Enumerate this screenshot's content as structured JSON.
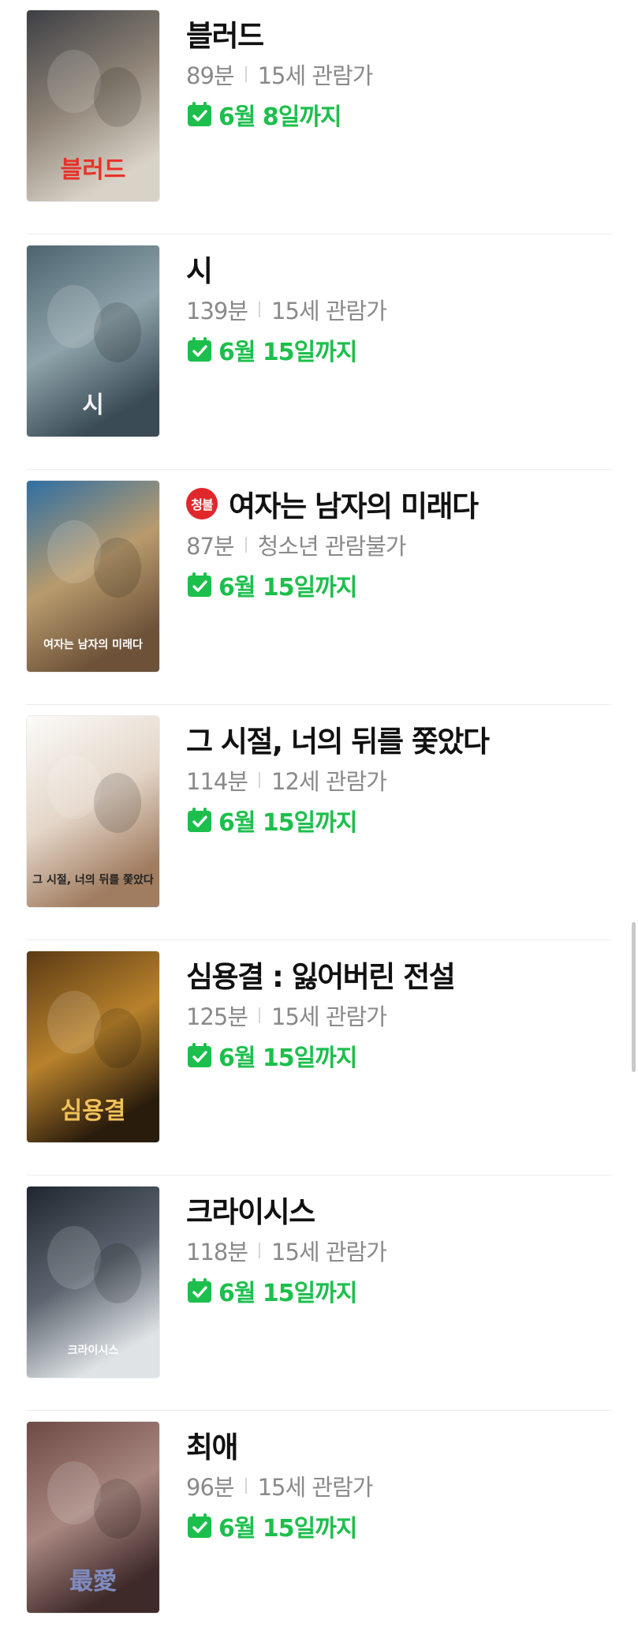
{
  "colors": {
    "accent_green": "#1dbf4c",
    "meta_gray": "#8a8a8a",
    "restricted_red": "#e0282c"
  },
  "icons": {
    "calendar": "calendar-check-icon"
  },
  "movies": [
    {
      "title": "블러드",
      "runtime": "89분",
      "rating": "15세 관람가",
      "until": "6월 8일까지",
      "badge": "",
      "poster_text": "블러드",
      "poster_colors": [
        "#3d3f44",
        "#8f8477",
        "#d9d2c7"
      ],
      "poster_text_color": "#e8322b"
    },
    {
      "title": "시",
      "runtime": "139분",
      "rating": "15세 관람가",
      "until": "6월 15일까지",
      "badge": "",
      "poster_text": "시",
      "poster_colors": [
        "#4d6470",
        "#8ea3aa",
        "#3a4b55"
      ],
      "poster_text_color": "#f2f2f2"
    },
    {
      "title": "여자는 남자의 미래다",
      "runtime": "87분",
      "rating": "청소년 관람불가",
      "until": "6월 15일까지",
      "badge": "청불",
      "poster_text": "여자는 남자의 미래다",
      "poster_colors": [
        "#2f6fa3",
        "#b89b6d",
        "#6d5239"
      ],
      "poster_text_color": "#ffffff"
    },
    {
      "title": "그 시절, 너의 뒤를 쫓았다",
      "runtime": "114분",
      "rating": "12세 관람가",
      "until": "6월 15일까지",
      "badge": "",
      "poster_text": "그 시절, 너의 뒤를 쫓았다",
      "poster_colors": [
        "#fbfbf9",
        "#e4d6c8",
        "#a07c60"
      ],
      "poster_text_color": "#222222"
    },
    {
      "title": "심용결 : 잃어버린 전설",
      "runtime": "125분",
      "rating": "15세 관람가",
      "until": "6월 15일까지",
      "badge": "",
      "poster_text": "심용결",
      "poster_colors": [
        "#5b3a14",
        "#b8822c",
        "#2a1c0c"
      ],
      "poster_text_color": "#f1c25a"
    },
    {
      "title": "크라이시스",
      "runtime": "118분",
      "rating": "15세 관람가",
      "until": "6월 15일까지",
      "badge": "",
      "poster_text": "크라이시스",
      "poster_colors": [
        "#1f2630",
        "#5d6670",
        "#dfe3e6"
      ],
      "poster_text_color": "#ffffff"
    },
    {
      "title": "최애",
      "runtime": "96분",
      "rating": "15세 관람가",
      "until": "6월 15일까지",
      "badge": "",
      "poster_text": "最愛",
      "poster_colors": [
        "#6e4a44",
        "#a88780",
        "#3f2a2a"
      ],
      "poster_text_color": "#7f8cc0"
    }
  ]
}
